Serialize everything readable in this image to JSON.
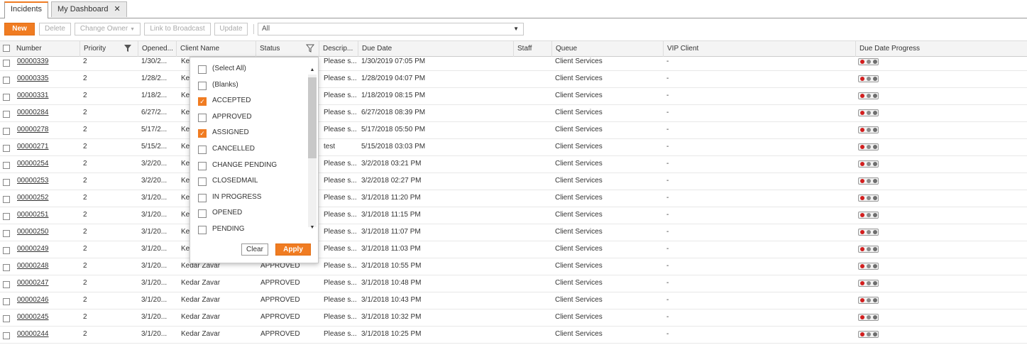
{
  "tabs": [
    {
      "label": "Incidents",
      "active": true
    },
    {
      "label": "My Dashboard",
      "active": false,
      "closable": true
    }
  ],
  "toolbar": {
    "new": "New",
    "delete": "Delete",
    "change_owner": "Change Owner",
    "link_to_broadcast": "Link to Broadcast",
    "update": "Update",
    "view_select": "All"
  },
  "columns": {
    "number": "Number",
    "priority": "Priority",
    "opened": "Opened...",
    "client_name": "Client Name",
    "status": "Status",
    "description": "Descrip...",
    "due_date": "Due Date",
    "staff": "Staff",
    "queue": "Queue",
    "vip_client": "VIP Client",
    "due_date_progress": "Due Date Progress"
  },
  "rows": [
    {
      "number": "00000339",
      "priority": "2",
      "opened": "1/30/2...",
      "client": "Ke",
      "status": "",
      "desc": "Please s...",
      "due": "1/30/2019 07:05 PM",
      "staff": "",
      "queue": "Client Services",
      "vip": "-"
    },
    {
      "number": "00000335",
      "priority": "2",
      "opened": "1/28/2...",
      "client": "Ke",
      "status": "",
      "desc": "Please s...",
      "due": "1/28/2019 04:07 PM",
      "staff": "",
      "queue": "Client Services",
      "vip": "-"
    },
    {
      "number": "00000331",
      "priority": "2",
      "opened": "1/18/2...",
      "client": "Ke",
      "status": "",
      "desc": "Please s...",
      "due": "1/18/2019 08:15 PM",
      "staff": "",
      "queue": "Client Services",
      "vip": "-"
    },
    {
      "number": "00000284",
      "priority": "2",
      "opened": "6/27/2...",
      "client": "Ke",
      "status": "",
      "desc": "Please s...",
      "due": "6/27/2018 08:39 PM",
      "staff": "",
      "queue": "Client Services",
      "vip": "-"
    },
    {
      "number": "00000278",
      "priority": "2",
      "opened": "5/17/2...",
      "client": "Ke",
      "status": "",
      "desc": "Please s...",
      "due": "5/17/2018 05:50 PM",
      "staff": "",
      "queue": "Client Services",
      "vip": "-"
    },
    {
      "number": "00000271",
      "priority": "2",
      "opened": "5/15/2...",
      "client": "Ke",
      "status": "",
      "desc": "test",
      "due": "5/15/2018 03:03 PM",
      "staff": "",
      "queue": "Client Services",
      "vip": "-"
    },
    {
      "number": "00000254",
      "priority": "2",
      "opened": "3/2/20...",
      "client": "Ke",
      "status": "",
      "desc": "Please s...",
      "due": "3/2/2018 03:21 PM",
      "staff": "",
      "queue": "Client Services",
      "vip": "-"
    },
    {
      "number": "00000253",
      "priority": "2",
      "opened": "3/2/20...",
      "client": "Ke",
      "status": "",
      "desc": "Please s...",
      "due": "3/2/2018 02:27 PM",
      "staff": "",
      "queue": "Client Services",
      "vip": "-"
    },
    {
      "number": "00000252",
      "priority": "2",
      "opened": "3/1/20...",
      "client": "Ke",
      "status": "",
      "desc": "Please s...",
      "due": "3/1/2018 11:20 PM",
      "staff": "",
      "queue": "Client Services",
      "vip": "-"
    },
    {
      "number": "00000251",
      "priority": "2",
      "opened": "3/1/20...",
      "client": "Ke",
      "status": "",
      "desc": "Please s...",
      "due": "3/1/2018 11:15 PM",
      "staff": "",
      "queue": "Client Services",
      "vip": "-"
    },
    {
      "number": "00000250",
      "priority": "2",
      "opened": "3/1/20...",
      "client": "Ke",
      "status": "",
      "desc": "Please s...",
      "due": "3/1/2018 11:07 PM",
      "staff": "",
      "queue": "Client Services",
      "vip": "-"
    },
    {
      "number": "00000249",
      "priority": "2",
      "opened": "3/1/20...",
      "client": "Ke",
      "status": "",
      "desc": "Please s...",
      "due": "3/1/2018 11:03 PM",
      "staff": "",
      "queue": "Client Services",
      "vip": "-"
    },
    {
      "number": "00000248",
      "priority": "2",
      "opened": "3/1/20...",
      "client": "Kedar Zavar",
      "status": "APPROVED",
      "desc": "Please s...",
      "due": "3/1/2018 10:55 PM",
      "staff": "",
      "queue": "Client Services",
      "vip": "-"
    },
    {
      "number": "00000247",
      "priority": "2",
      "opened": "3/1/20...",
      "client": "Kedar Zavar",
      "status": "APPROVED",
      "desc": "Please s...",
      "due": "3/1/2018 10:48 PM",
      "staff": "",
      "queue": "Client Services",
      "vip": "-"
    },
    {
      "number": "00000246",
      "priority": "2",
      "opened": "3/1/20...",
      "client": "Kedar Zavar",
      "status": "APPROVED",
      "desc": "Please s...",
      "due": "3/1/2018 10:43 PM",
      "staff": "",
      "queue": "Client Services",
      "vip": "-"
    },
    {
      "number": "00000245",
      "priority": "2",
      "opened": "3/1/20...",
      "client": "Kedar Zavar",
      "status": "APPROVED",
      "desc": "Please s...",
      "due": "3/1/2018 10:32 PM",
      "staff": "",
      "queue": "Client Services",
      "vip": "-"
    },
    {
      "number": "00000244",
      "priority": "2",
      "opened": "3/1/20...",
      "client": "Kedar Zavar",
      "status": "APPROVED",
      "desc": "Please s...",
      "due": "3/1/2018 10:25 PM",
      "staff": "",
      "queue": "Client Services",
      "vip": "-"
    }
  ],
  "progress_colors": [
    "#d21f1f",
    "#8a8a8a",
    "#6e6e6e"
  ],
  "status_filter": {
    "options": [
      {
        "label": "(Select All)",
        "checked": false
      },
      {
        "label": "(Blanks)",
        "checked": false
      },
      {
        "label": "ACCEPTED",
        "checked": true
      },
      {
        "label": "APPROVED",
        "checked": false
      },
      {
        "label": "ASSIGNED",
        "checked": true
      },
      {
        "label": "CANCELLED",
        "checked": false
      },
      {
        "label": "CHANGE PENDING",
        "checked": false
      },
      {
        "label": "CLOSEDMAIL",
        "checked": false
      },
      {
        "label": "IN PROGRESS",
        "checked": false
      },
      {
        "label": "OPENED",
        "checked": false
      },
      {
        "label": "PENDING",
        "checked": false
      }
    ],
    "clear": "Clear",
    "apply": "Apply"
  },
  "accent_color": "#f07c22"
}
